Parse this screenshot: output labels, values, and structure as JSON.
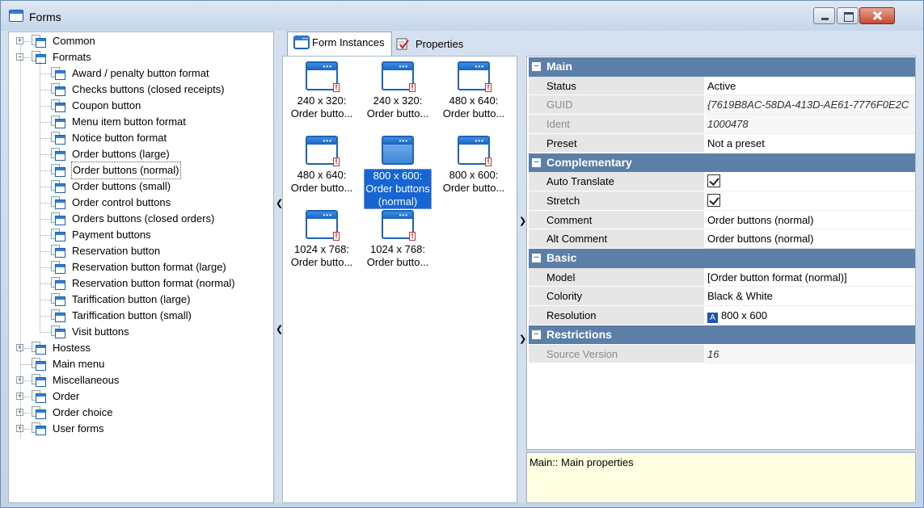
{
  "window": {
    "title": "Forms"
  },
  "tree": [
    {
      "label": "Common",
      "level": 0,
      "expander": "+"
    },
    {
      "label": "Formats",
      "level": 0,
      "expander": "-"
    },
    {
      "label": "Award / penalty button format",
      "level": 1
    },
    {
      "label": "Checks buttons (closed receipts)",
      "level": 1
    },
    {
      "label": "Coupon button",
      "level": 1
    },
    {
      "label": "Menu item button format",
      "level": 1
    },
    {
      "label": "Notice button format",
      "level": 1
    },
    {
      "label": "Order buttons (large)",
      "level": 1
    },
    {
      "label": "Order buttons (normal)",
      "level": 1,
      "selected": true
    },
    {
      "label": "Order buttons (small)",
      "level": 1
    },
    {
      "label": "Order control buttons",
      "level": 1
    },
    {
      "label": "Orders buttons (closed orders)",
      "level": 1
    },
    {
      "label": "Payment buttons",
      "level": 1
    },
    {
      "label": "Reservation button",
      "level": 1
    },
    {
      "label": "Reservation button format (large)",
      "level": 1
    },
    {
      "label": "Reservation button format (normal)",
      "level": 1
    },
    {
      "label": "Tariffication button (large)",
      "level": 1
    },
    {
      "label": "Tariffication button (small)",
      "level": 1
    },
    {
      "label": "Visit buttons",
      "level": 1
    },
    {
      "label": "Hostess",
      "level": 0,
      "expander": "+"
    },
    {
      "label": "Main menu",
      "level": 0
    },
    {
      "label": "Miscellaneous",
      "level": 0,
      "expander": "+"
    },
    {
      "label": "Order",
      "level": 0,
      "expander": "+"
    },
    {
      "label": "Order choice",
      "level": 0,
      "expander": "+"
    },
    {
      "label": "User forms",
      "level": 0,
      "expander": "+"
    }
  ],
  "tabs": [
    {
      "label": "Form Instances",
      "active": true,
      "icon": "form-icon"
    },
    {
      "label": "Properties",
      "active": false,
      "icon": "properties-icon"
    }
  ],
  "instances": [
    {
      "line1": "240 x 320:",
      "line2": "Order butto..."
    },
    {
      "line1": "240 x 320:",
      "line2": "Order butto..."
    },
    {
      "line1": "480 x 640:",
      "line2": "Order butto..."
    },
    {
      "line1": "480 x 640:",
      "line2": "Order butto..."
    },
    {
      "line1": "800 x 600:",
      "line2": "Order buttons",
      "line3": "(normal)",
      "selected": true
    },
    {
      "line1": "800 x 600:",
      "line2": "Order butto..."
    },
    {
      "line1": "1024 x 768:",
      "line2": "Order butto..."
    },
    {
      "line1": "1024 x 768:",
      "line2": "Order butto..."
    }
  ],
  "properties": [
    {
      "category": "Main"
    },
    {
      "name": "Status",
      "value": "Active"
    },
    {
      "name": "GUID",
      "value": "{7619B8AC-58DA-413D-AE61-7776F0E2C",
      "readonly": true
    },
    {
      "name": "Ident",
      "value": "1000478",
      "readonly": true
    },
    {
      "name": "Preset",
      "value": "Not a preset"
    },
    {
      "category": "Complementary"
    },
    {
      "name": "Auto Translate",
      "checkbox": true
    },
    {
      "name": "Stretch",
      "checkbox": true
    },
    {
      "name": "Comment",
      "value": "Order buttons (normal)"
    },
    {
      "name": "Alt Comment",
      "value": "Order buttons (normal)"
    },
    {
      "category": "Basic"
    },
    {
      "name": "Model",
      "value": "[Order button format (normal)]"
    },
    {
      "name": "Colority",
      "value": "Black & White"
    },
    {
      "name": "Resolution",
      "value": "800 x 600",
      "badge": "A"
    },
    {
      "category": "Restrictions"
    },
    {
      "name": "Source Version",
      "value": "16",
      "readonly": true
    }
  ],
  "description": "Main:: Main properties",
  "colors": {
    "category_bg": "#5c7fa8",
    "selection": "#1665d2",
    "description_bg": "#ffffe1"
  }
}
